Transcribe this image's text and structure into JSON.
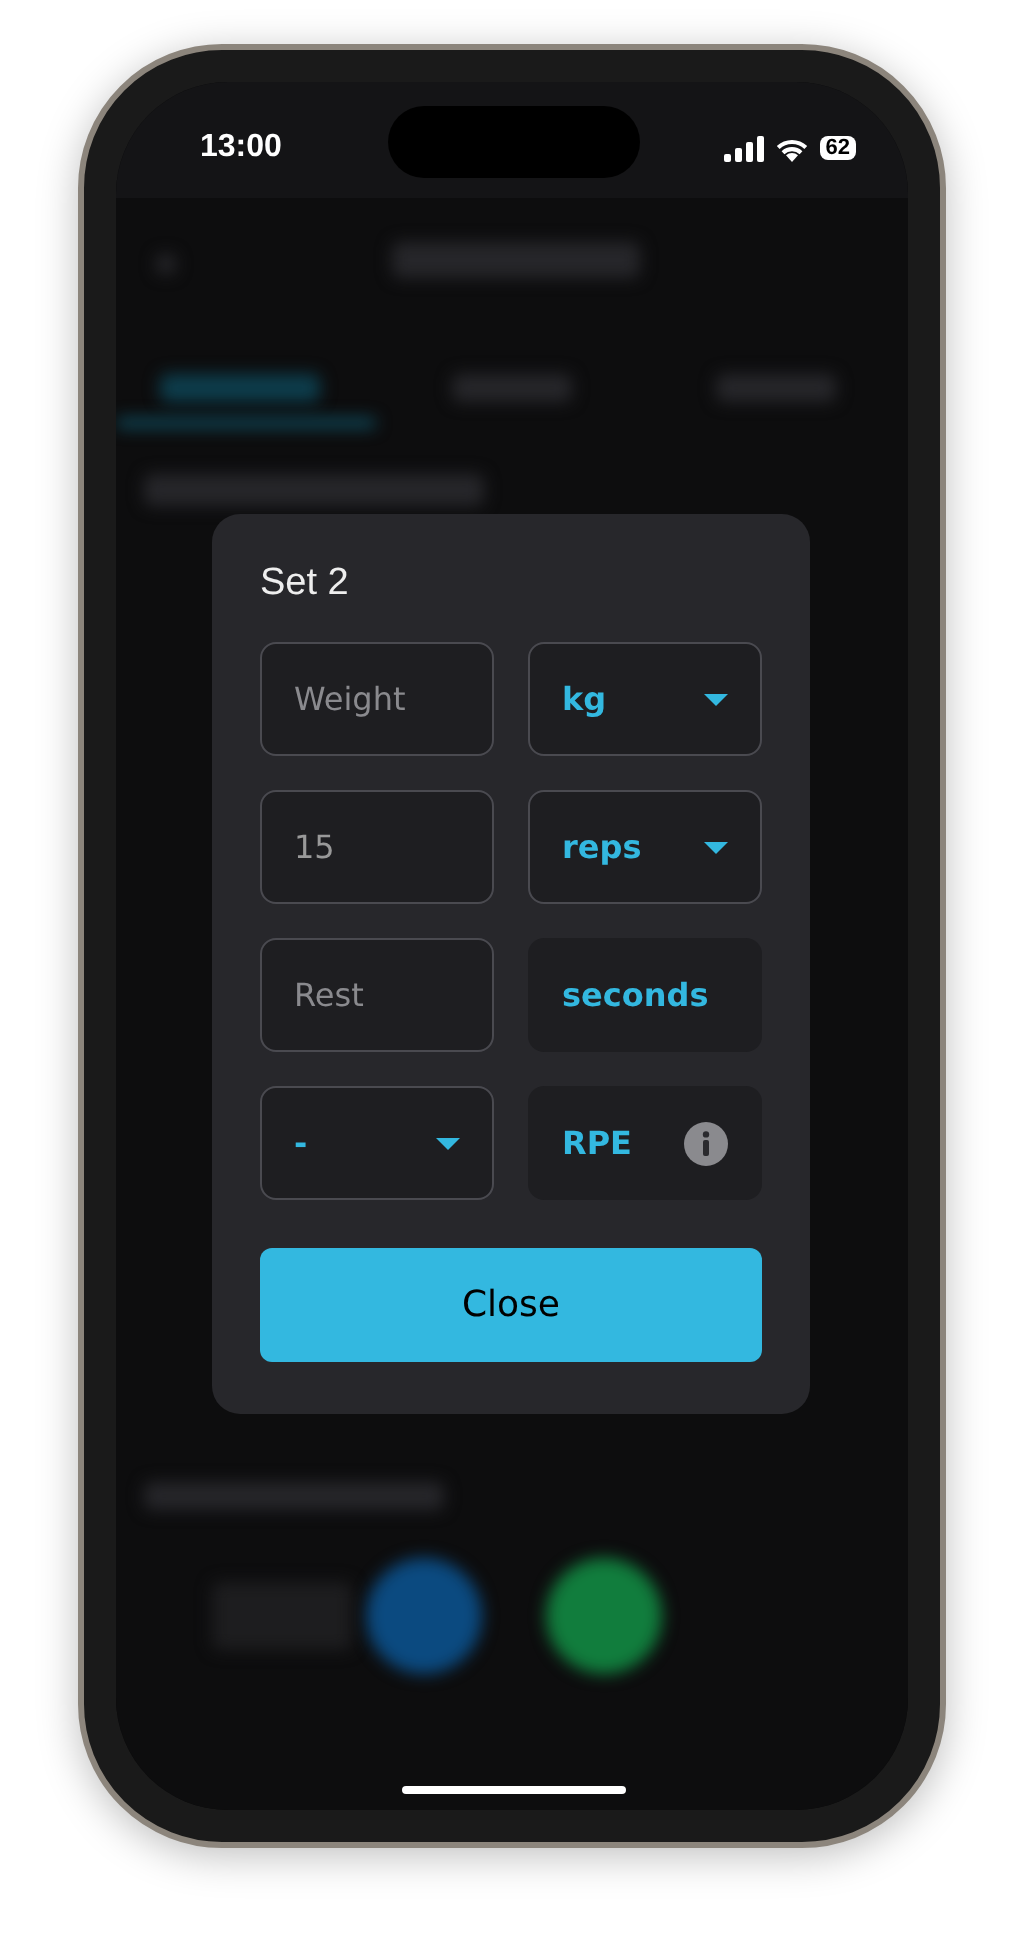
{
  "status_bar": {
    "time": "13:00",
    "battery": "62"
  },
  "dialog": {
    "title": "Set 2",
    "rows": [
      {
        "left": {
          "kind": "input",
          "placeholder": "Weight"
        },
        "right": {
          "kind": "dropdown",
          "value": "kg"
        }
      },
      {
        "left": {
          "kind": "input",
          "value": "15"
        },
        "right": {
          "kind": "dropdown",
          "value": "reps"
        }
      },
      {
        "left": {
          "kind": "input",
          "placeholder": "Rest"
        },
        "right": {
          "kind": "label",
          "text": "seconds",
          "info": false
        }
      },
      {
        "left": {
          "kind": "dropdown",
          "value": "-"
        },
        "right": {
          "kind": "label",
          "text": "RPE",
          "info": true
        }
      }
    ],
    "button": "Close"
  }
}
